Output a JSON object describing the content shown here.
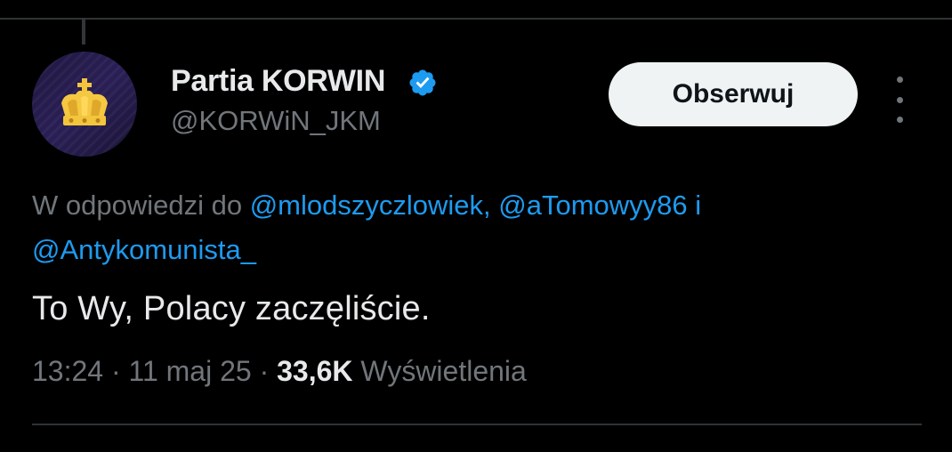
{
  "author": {
    "display_name": "Partia KORWIN",
    "handle": "@KORWiN_JKM",
    "verified": true,
    "avatar_icon": "golden-crown-icon"
  },
  "follow_button_label": "Obserwuj",
  "more_icon": "vertical-ellipsis-icon",
  "reply_context": {
    "prefix": "W odpowiedzi do",
    "mention_1": "@mlodszyczlowiek,",
    "mention_2": "@aTomowyy86",
    "conjunction": "i",
    "mention_3": "@Antykomunista_"
  },
  "tweet_text": "To Wy, Polacy zaczęliście.",
  "meta": {
    "time": "13:24",
    "separator": "·",
    "date": "11 maj 25",
    "views_count": "33,6K",
    "views_label": "Wyświetlenia"
  },
  "colors": {
    "background": "#000000",
    "primary_text": "#e7e9ea",
    "secondary_text": "#71767b",
    "link": "#1d9bf0",
    "verified": "#1d9bf0",
    "divider": "#2f3336",
    "follow_button_bg": "#eff3f4"
  }
}
